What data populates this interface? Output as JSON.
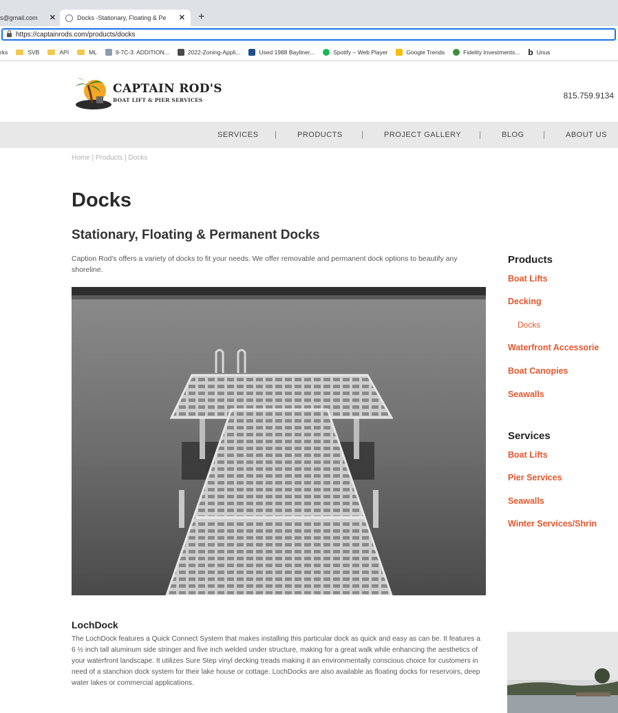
{
  "browser": {
    "tabs": [
      {
        "title": "s@gmail.com",
        "active": false
      },
      {
        "title": "Docks -Stationary, Floating & Pe",
        "active": true
      }
    ],
    "url": "https://captainrods.com/products/docks",
    "bookmarks": [
      {
        "label": "rks",
        "icon": "none"
      },
      {
        "label": "SVB",
        "icon": "folder-icon"
      },
      {
        "label": "API",
        "icon": "folder-icon"
      },
      {
        "label": "ML",
        "icon": "folder-icon"
      },
      {
        "label": "9-7C-3: ADDITION...",
        "icon": "page-icon"
      },
      {
        "label": "2022-Zoning-Appli...",
        "icon": "map-icon"
      },
      {
        "label": "Used 1988 Bayliner...",
        "icon": "site-icon"
      },
      {
        "label": "Spotify – Web Player",
        "icon": "spotify-icon"
      },
      {
        "label": "Google Trends",
        "icon": "trends-icon"
      },
      {
        "label": "Fidelity Investments...",
        "icon": "fidelity-icon"
      },
      {
        "label": "Unus",
        "icon": "bing-icon"
      }
    ]
  },
  "site": {
    "logo_title": "CAPTAIN ROD'S",
    "logo_subtitle": "BOAT LIFT & PIER SERVICES",
    "phone": "815.759.9134",
    "nav": [
      "SERVICES",
      "PRODUCTS",
      "PROJECT GALLERY",
      "BLOG",
      "ABOUT US"
    ],
    "nav_separator": "|",
    "breadcrumb": "Home  |  Products  |  Docks"
  },
  "main": {
    "title": "Docks",
    "subtitle": "Stationary, Floating & Permanent Docks",
    "intro": "Caption Rod's offers a variety of docks to fit your needs. We offer removable and permanent dock options to beautify any shoreline.",
    "section_title": "LochDock",
    "section_body": "The LochDock features a Quick Connect System that makes installing this particular dock as quick and easy as can be. It features a 6 ½ inch tall aluminum side stringer and five inch welded under structure, making for a great walk while enhancing the aesthetics of your waterfront landscape. It utilizes Sure Step vinyl decking treads making it an environmentally conscious choice for customers in need of a stanchion dock system for their lake house or cottage. LochDocks are also available as floating docks for reservoirs, deep water lakes or commercial applications."
  },
  "sidebar": {
    "products_heading": "Products",
    "products": [
      "Boat Lifts",
      "Decking",
      "Docks",
      "Waterfront Accessorie",
      "Boat Canopies",
      "Seawalls"
    ],
    "services_heading": "Services",
    "services": [
      "Boat Lifts",
      "Pier Services",
      "Seawalls",
      "Winter Services/Shrin"
    ]
  },
  "colors": {
    "accent": "#e4572e",
    "nav_bg": "#e8e8e8",
    "chrome_bg": "#dee1e6",
    "url_focus": "#1a73e8"
  }
}
